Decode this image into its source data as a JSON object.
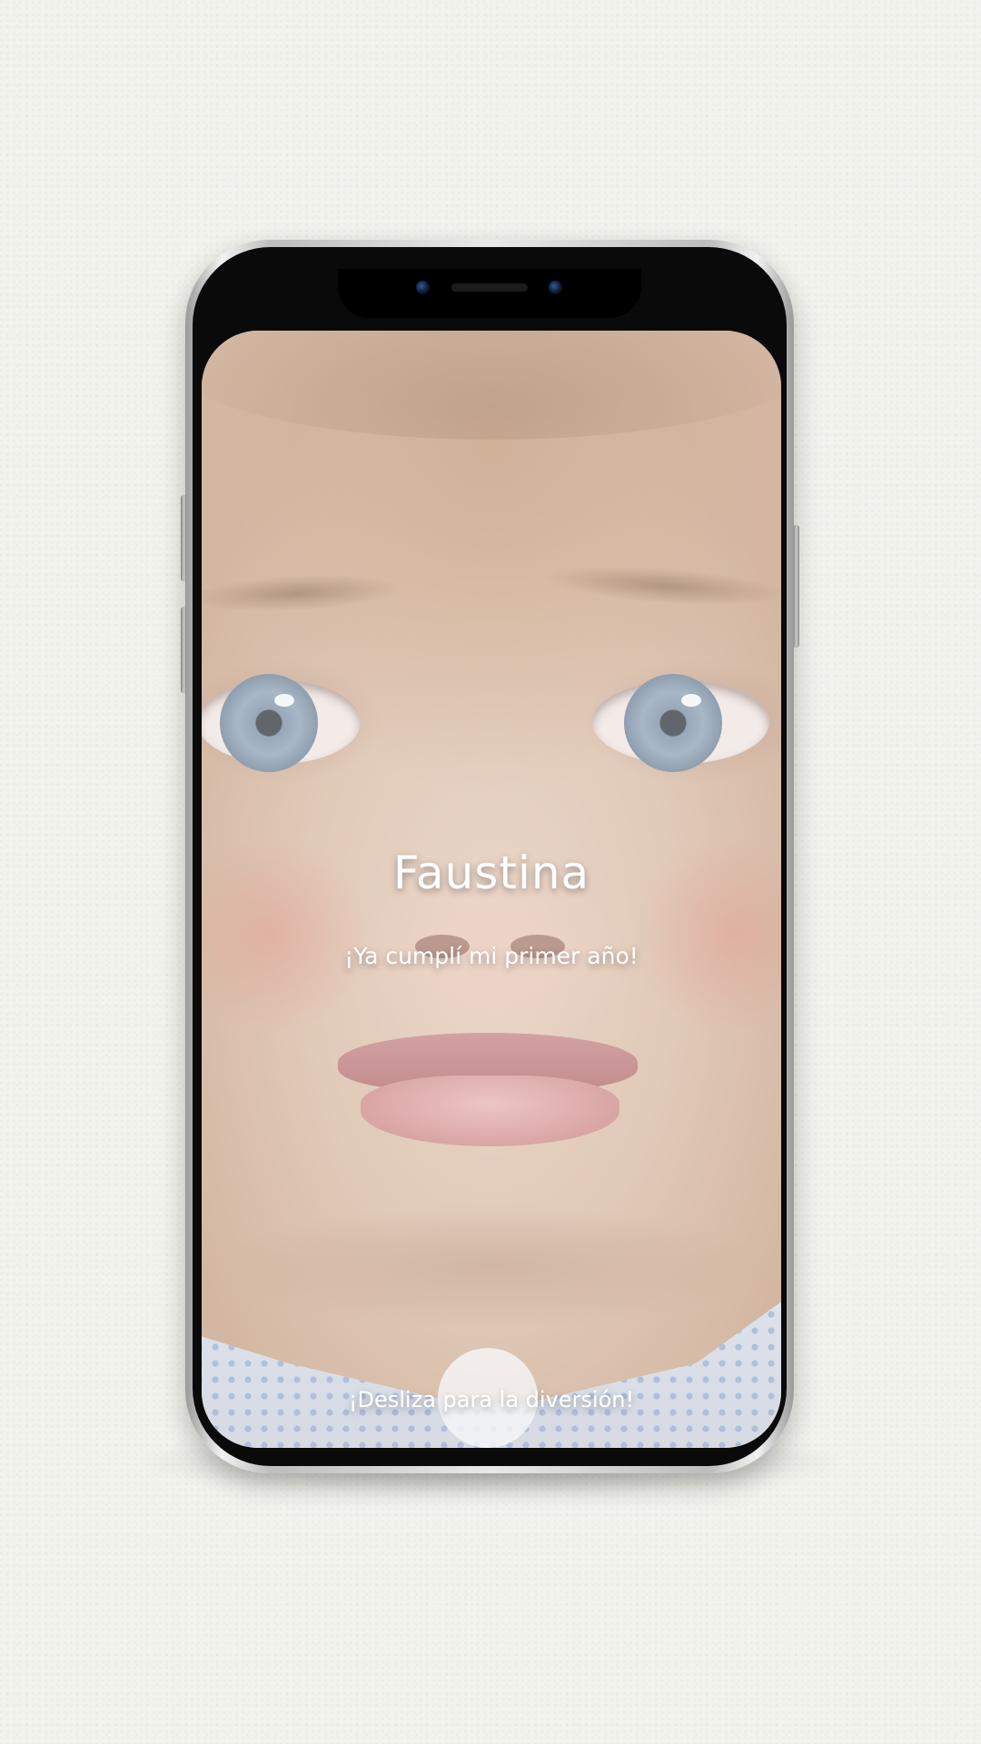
{
  "screen": {
    "title": "Faustina",
    "subtitle": "¡Ya cumplí mi primer año!",
    "swipe_hint": "¡Desliza para la diversión!"
  },
  "colors": {
    "background": "#f3f3ee",
    "text": "#ffffff",
    "phone_frame": "#0a0a0a"
  }
}
